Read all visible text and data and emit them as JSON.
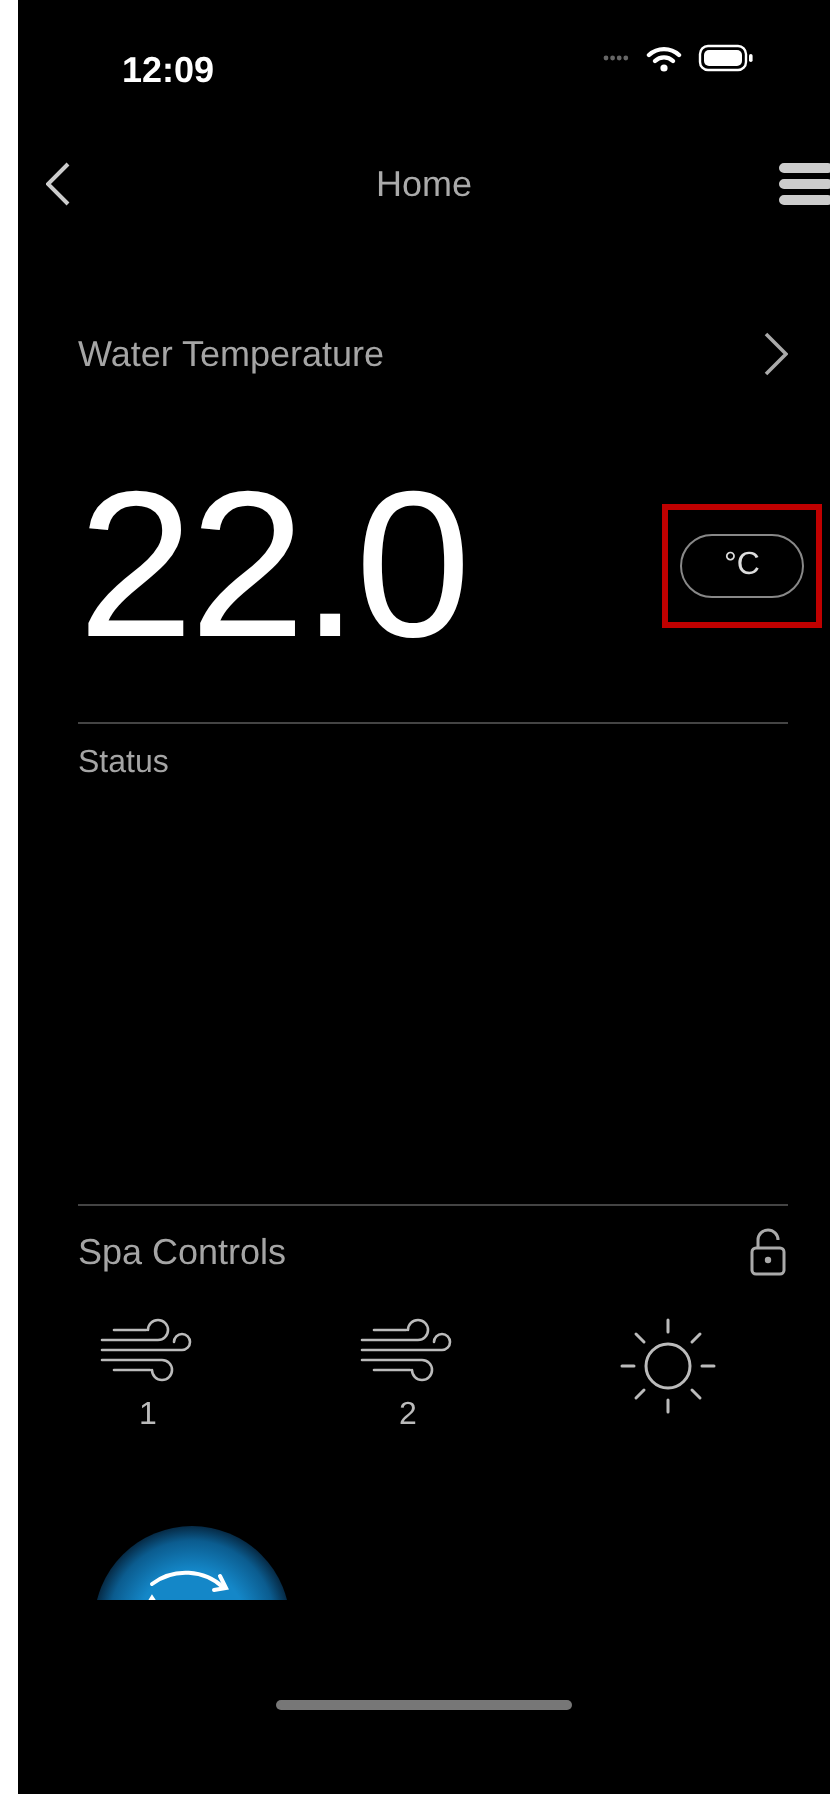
{
  "status_bar": {
    "time": "12:09"
  },
  "nav": {
    "title": "Home"
  },
  "water_temperature": {
    "title": "Water Temperature",
    "value": "22.0",
    "unit": {
      "label": "°C",
      "highlighted": true
    }
  },
  "status": {
    "title": "Status"
  },
  "spa_controls": {
    "title": "Spa Controls",
    "locked": false,
    "items": [
      {
        "kind": "jet",
        "label": "1"
      },
      {
        "kind": "jet",
        "label": "2"
      },
      {
        "kind": "light"
      }
    ]
  }
}
